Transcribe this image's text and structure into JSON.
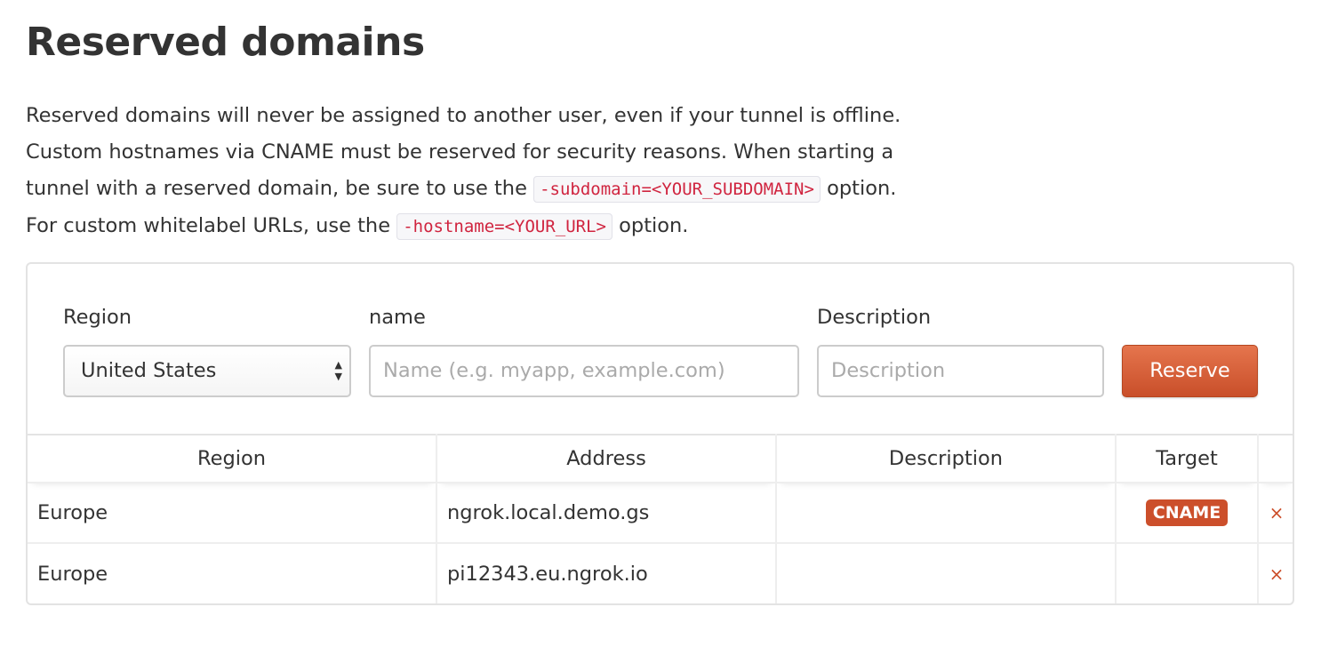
{
  "title": "Reserved domains",
  "intro": {
    "l1": "Reserved domains will never be assigned to another user, even if your tunnel is offline.",
    "l2": "Custom hostnames via CNAME must be reserved for security reasons. When starting a",
    "l3a": "tunnel with a reserved domain, be sure to use the",
    "l3code": "-subdomain=<YOUR_SUBDOMAIN>",
    "l3b": "option.",
    "l4a": "For custom whitelabel URLs, use the",
    "l4code": "-hostname=<YOUR_URL>",
    "l4b": "option."
  },
  "form": {
    "region_label": "Region",
    "region_value": "United States",
    "name_label": "name",
    "name_placeholder": "Name (e.g. myapp, example.com)",
    "desc_label": "Description",
    "desc_placeholder": "Description",
    "reserve": "Reserve"
  },
  "table": {
    "headers": [
      "Region",
      "Address",
      "Description",
      "Target",
      ""
    ],
    "rows": [
      {
        "region": "Europe",
        "address": "ngrok.local.demo.gs",
        "description": "",
        "target": "CNAME",
        "delete": "×"
      },
      {
        "region": "Europe",
        "address": "pi12343.eu.ngrok.io",
        "description": "",
        "target": "",
        "delete": "×"
      }
    ]
  },
  "colors": {
    "accent": "#cc4f2b",
    "code": "#d0243f"
  }
}
